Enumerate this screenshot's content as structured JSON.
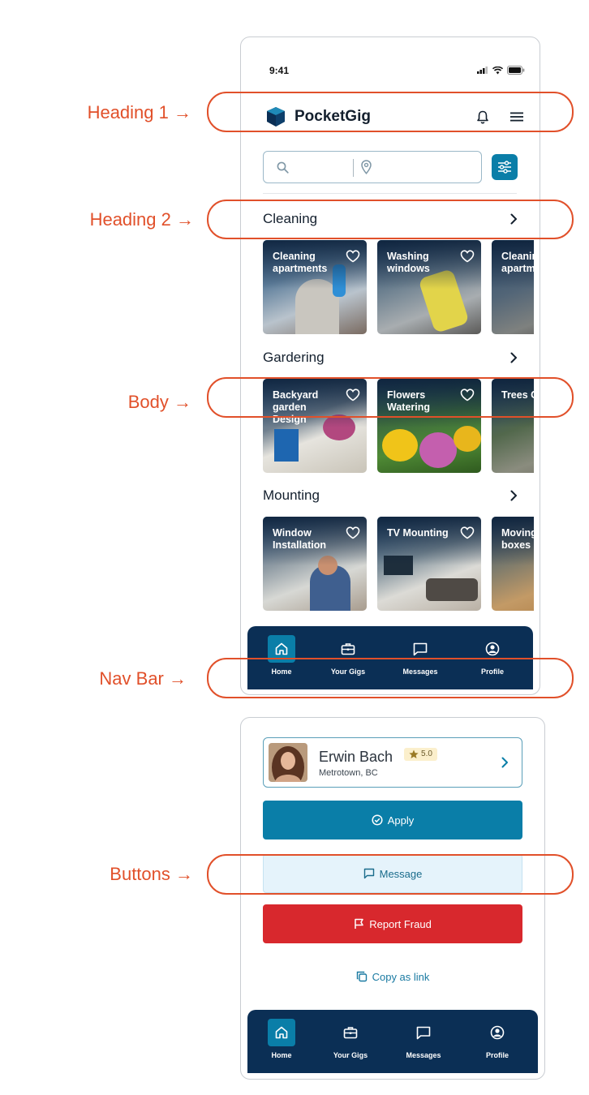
{
  "annotations": {
    "heading1": "Heading 1 →",
    "heading2": "Heading 2 →",
    "body": "Body →",
    "navbar": "Nav Bar →",
    "buttons": "Buttons →"
  },
  "status_bar": {
    "time": "9:41"
  },
  "header": {
    "app_name": "PocketGig"
  },
  "colors": {
    "accent": "#0a7ea8",
    "nav": "#0b2f55",
    "danger": "#d8282d",
    "annotation": "#e1502a"
  },
  "sections": [
    {
      "title": "Cleaning",
      "cards": [
        {
          "label": "Cleaning apartments",
          "icon": "heart-icon"
        },
        {
          "label": "Washing windows",
          "icon": "heart-icon"
        },
        {
          "label": "Cleaning apartments",
          "icon": "heart-icon"
        }
      ]
    },
    {
      "title": "Gardering",
      "cards": [
        {
          "label": "Backyard garden Design",
          "icon": "heart-icon"
        },
        {
          "label": "Flowers Watering",
          "icon": "heart-icon"
        },
        {
          "label": "Trees Cutting",
          "icon": "heart-icon"
        }
      ]
    },
    {
      "title": "Mounting",
      "cards": [
        {
          "label": "Window Installation",
          "icon": "heart-icon"
        },
        {
          "label": "TV Mounting",
          "icon": "heart-icon"
        },
        {
          "label": "Moving boxes",
          "icon": "heart-icon"
        }
      ]
    }
  ],
  "nav": {
    "items": [
      {
        "label": "Home",
        "icon": "home-icon",
        "active": true
      },
      {
        "label": "Your Gigs",
        "icon": "briefcase-icon"
      },
      {
        "label": "Messages",
        "icon": "message-icon"
      },
      {
        "label": "Profile",
        "icon": "profile-icon"
      }
    ]
  },
  "detail": {
    "name": "Erwin Bach",
    "location": "Metrotown, BC",
    "rating": "5.0",
    "apply": "Apply",
    "message": "Message",
    "report": "Report Fraud",
    "copy": "Copy as link"
  }
}
